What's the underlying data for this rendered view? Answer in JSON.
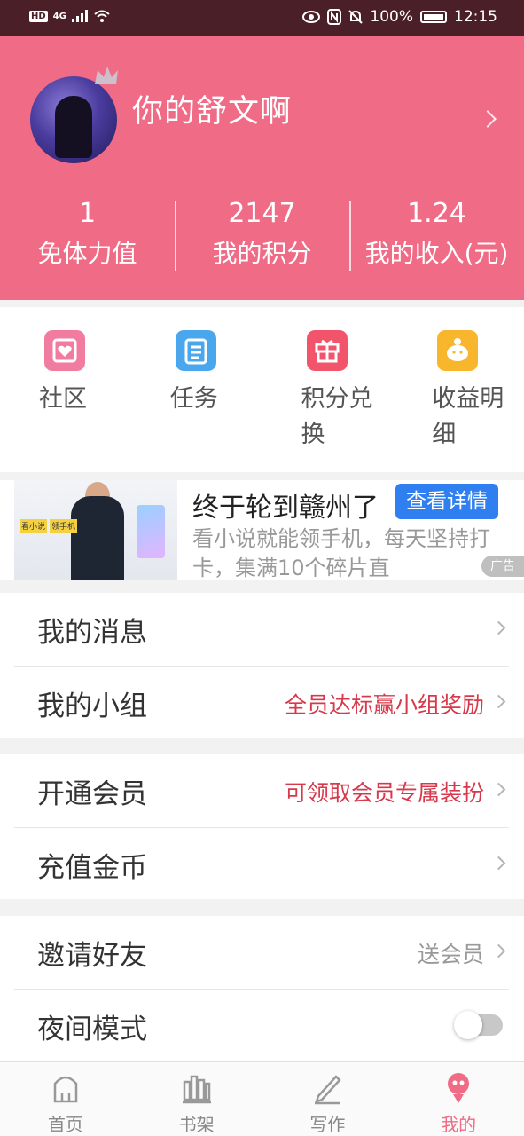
{
  "status_bar": {
    "left_badge": "HD",
    "network": "4G",
    "battery": "100%",
    "time": "12:15"
  },
  "profile": {
    "username": "你的舒文啊"
  },
  "stats": [
    {
      "value": "1",
      "label": "免体力值"
    },
    {
      "value": "2147",
      "label": "我的积分"
    },
    {
      "value": "1.24",
      "label": "我的收入(元)"
    }
  ],
  "quick_actions": [
    {
      "label": "社区",
      "icon": "community-icon",
      "color": "#f27ba0"
    },
    {
      "label": "任务",
      "icon": "task-icon",
      "color": "#4aa7ee"
    },
    {
      "label": "积分兑换",
      "icon": "gift-icon",
      "color": "#f2546b"
    },
    {
      "label": "收益明细",
      "icon": "piggy-bank-icon",
      "color": "#f8b62d"
    }
  ],
  "ad": {
    "title": "终于轮到赣州了",
    "button": "查看详情",
    "description": "看小说就能领手机，每天坚持打卡，集满10个碎片直",
    "badge": "广告",
    "image_tags": [
      "看小说",
      "领手机"
    ]
  },
  "menu": {
    "group1": [
      {
        "label": "我的消息",
        "extra": ""
      },
      {
        "label": "我的小组",
        "extra": "全员达标赢小组奖励"
      }
    ],
    "group2": [
      {
        "label": "开通会员",
        "extra": "可领取会员专属装扮"
      },
      {
        "label": "充值金币",
        "extra": ""
      }
    ],
    "group3": [
      {
        "label": "邀请好友",
        "extra": "送会员"
      },
      {
        "label": "夜间模式",
        "toggle": false
      }
    ]
  },
  "bottom_nav": [
    {
      "label": "首页",
      "icon": "home-icon",
      "active": false
    },
    {
      "label": "书架",
      "icon": "bookshelf-icon",
      "active": false
    },
    {
      "label": "写作",
      "icon": "pen-icon",
      "active": false
    },
    {
      "label": "我的",
      "icon": "profile-icon",
      "active": true
    }
  ],
  "colors": {
    "brand": "#ef6b86",
    "status_bar": "#4a1f27",
    "accent_text": "#d8384b",
    "ad_button": "#2f7ff0"
  }
}
